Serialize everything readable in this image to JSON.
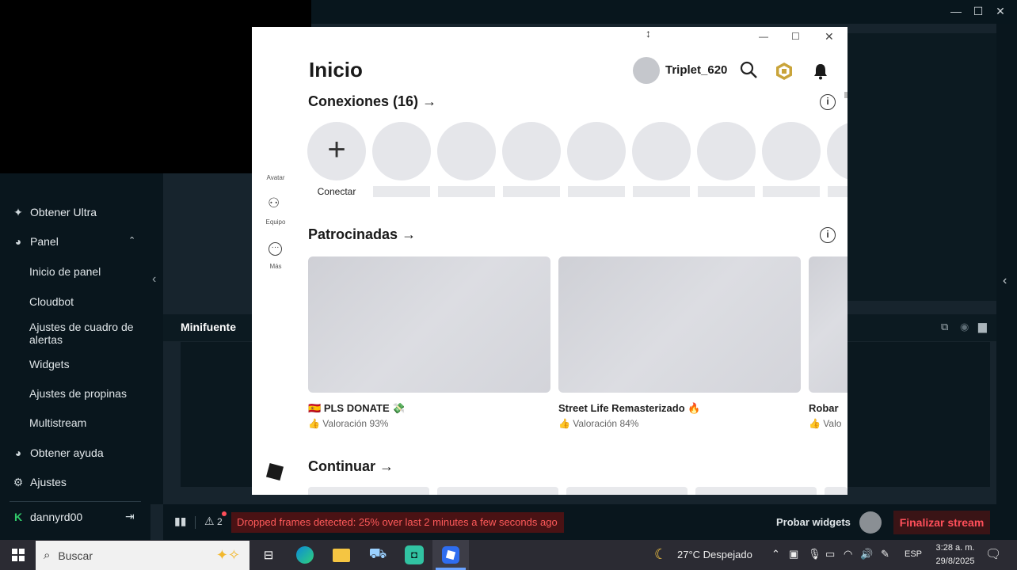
{
  "obs": {
    "sidebar": {
      "ultra": "Obtener Ultra",
      "panel": "Panel",
      "sub": [
        "Inicio de panel",
        "Cloudbot",
        "Ajustes de cuadro de alertas",
        "Widgets",
        "Ajustes de propinas",
        "Multistream"
      ],
      "help": "Obtener ayuda",
      "settings": "Ajustes",
      "user": "dannyrd00"
    },
    "minisource": "Minifuente",
    "footer": {
      "alert_count": "2",
      "alert": "Dropped frames detected: 25% over last 2 minutes a few seconds ago",
      "test_widgets": "Probar widgets",
      "end_stream": "Finalizar stream"
    }
  },
  "roblox": {
    "title": "Inicio",
    "username": "Triplet_620",
    "nav": {
      "avatar": "Avatar",
      "team": "Equipo",
      "more": "Más"
    },
    "connections": {
      "title": "Conexiones (16)",
      "connect": "Conectar"
    },
    "sponsored": {
      "title": "Patrocinadas",
      "cards": [
        {
          "flag": "🇪🇸",
          "title": "PLS DONATE",
          "emoji": "💸",
          "rating": "Valoración 93%"
        },
        {
          "flag": "",
          "title": "Street Life Remasterizado",
          "emoji": "🔥",
          "rating": "Valoración 84%"
        },
        {
          "flag": "",
          "title": "Robar",
          "emoji": "",
          "rating": "Valo"
        }
      ]
    },
    "continue": "Continuar"
  },
  "taskbar": {
    "search_placeholder": "Buscar",
    "weather": "27°C  Despejado",
    "lang": "ESP",
    "time": "3:28 a. m.",
    "date": "29/8/2025"
  },
  "colors": {
    "alert_bg": "#4a1214",
    "alert_text": "#ff5a5a",
    "end_stream": "#ff4f5a",
    "taskbar": "#2b2b33"
  }
}
